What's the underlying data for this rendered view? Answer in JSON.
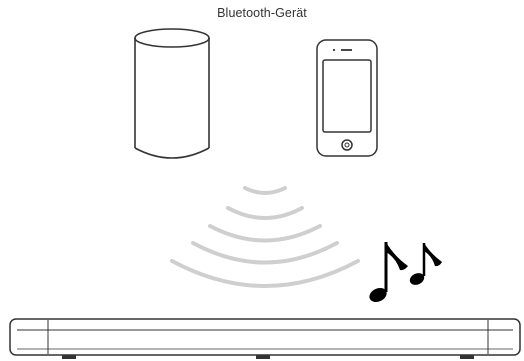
{
  "caption": {
    "label": "Bluetooth-Gerät"
  },
  "colors": {
    "outline": "#333333",
    "waves": "#cfcfcf",
    "notes": "#000000",
    "background": "#ffffff"
  },
  "icons": {
    "speaker": "bluetooth-speaker-icon",
    "phone": "smartphone-icon",
    "waves": "wireless-signal-icon",
    "notes": "music-notes-icon",
    "soundbar": "soundbar-icon"
  }
}
